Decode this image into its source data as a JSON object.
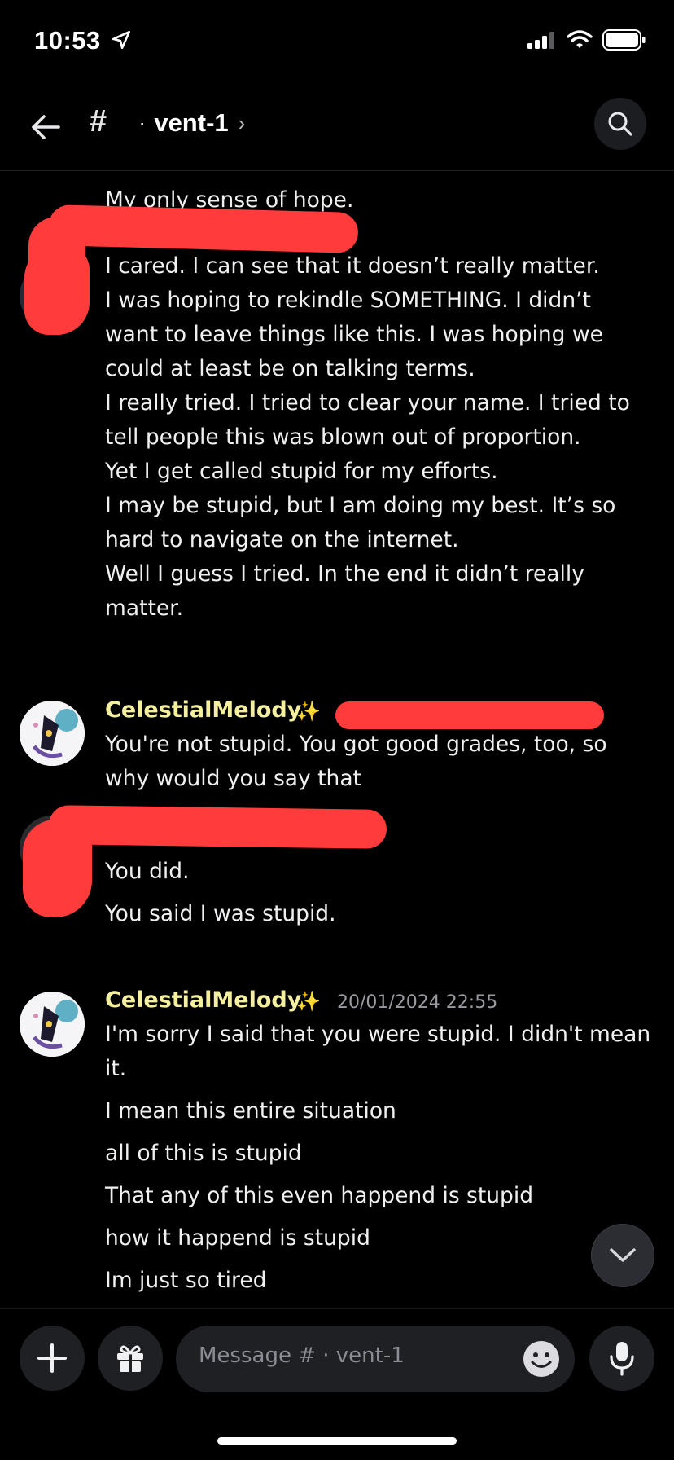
{
  "status_bar": {
    "time": "10:53",
    "location_icon": "location-arrow-icon",
    "signal_icon": "cellular-signal-icon",
    "wifi_icon": "wifi-icon",
    "battery_icon": "battery-icon"
  },
  "header": {
    "back_icon": "arrow-left-icon",
    "channel_prefix": "#",
    "channel_dot": "·",
    "channel_name": "vent-1",
    "chevron": "›",
    "search_icon": "search-icon"
  },
  "messages": [
    {
      "lines": [
        "My only sense of hope."
      ]
    },
    {
      "author_redacted": true,
      "lines": [
        "I cared. I can see that it doesn’t really matter.",
        "I was hoping to rekindle SOMETHING. I didn’t",
        "want to leave things like this. I was hoping we",
        "could at least be on talking terms.",
        "I really tried. I tried to clear your name. I tried to",
        "tell people this was blown out of proportion.",
        "Yet I get called stupid for my efforts.",
        "I may be stupid, but I am doing my best. It’s so",
        "hard to navigate on the internet.",
        "Well I guess I tried. In the end it didn’t really",
        "matter."
      ]
    },
    {
      "author": "CelestialMelody",
      "badge": "✨",
      "timestamp_redacted": true,
      "lines": [
        "You're not stupid. You got good grades, too, so",
        "why would you say that"
      ]
    },
    {
      "author_redacted": true,
      "lines": [
        "You did.",
        "You said I was stupid."
      ]
    },
    {
      "author": "CelestialMelody",
      "badge": "✨",
      "timestamp": "20/01/2024 22:55",
      "lines": [
        "I'm sorry I said that you were stupid. I didn't mean",
        "it.",
        "I mean this entire situation",
        "all of this is stupid",
        "That any of this even happend is stupid",
        "how it happend is stupid",
        "Im just so tired"
      ]
    }
  ],
  "composer": {
    "add_icon": "plus-icon",
    "gift_icon": "gift-icon",
    "placeholder": "Message # · vent-1",
    "emoji_icon": "smiley-icon",
    "mic_icon": "microphone-icon"
  },
  "scroll_button_icon": "chevron-down-icon",
  "colors": {
    "background": "#000000",
    "username": "#f5f0a0",
    "redaction": "#ff3b3b",
    "timestamp": "#9a9aa2"
  }
}
